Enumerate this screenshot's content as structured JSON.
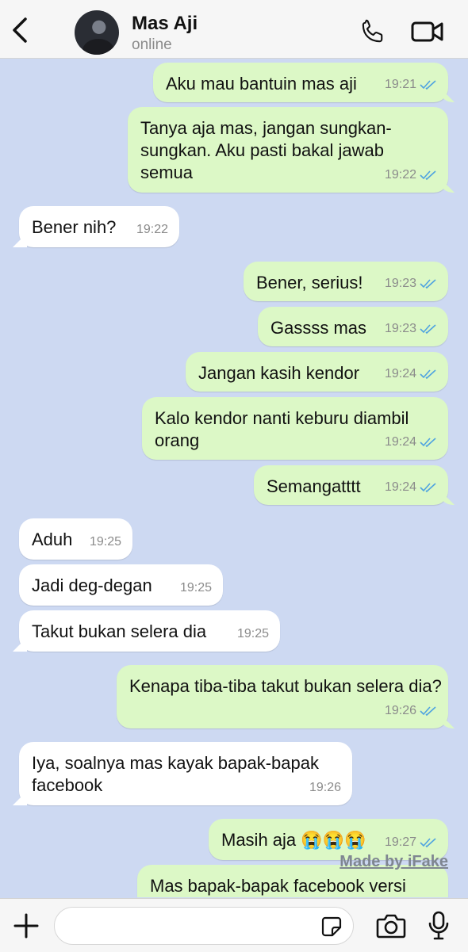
{
  "header": {
    "contact_name": "Mas Aji",
    "status": "online",
    "back_icon": "chevron-left-icon",
    "call_icon": "phone-icon",
    "video_icon": "video-camera-icon"
  },
  "messages": [
    {
      "dir": "out",
      "text": "Aku mau bantuin mas aji",
      "time": "19:21",
      "read": true
    },
    {
      "dir": "out",
      "text": "Tanya aja mas, jangan sungkan-sungkan. Aku pasti bakal jawab semua",
      "time": "19:22",
      "read": true
    },
    {
      "dir": "in",
      "text": "Bener nih?",
      "time": "19:22"
    },
    {
      "dir": "out",
      "text": "Bener, serius!",
      "time": "19:23",
      "read": true
    },
    {
      "dir": "out",
      "text": "Gassss mas",
      "time": "19:23",
      "read": true
    },
    {
      "dir": "out",
      "text": "Jangan kasih kendor",
      "time": "19:24",
      "read": true
    },
    {
      "dir": "out",
      "text": "Kalo kendor nanti keburu diambil orang",
      "time": "19:24",
      "read": true
    },
    {
      "dir": "out",
      "text": "Semangatttt",
      "time": "19:24",
      "read": true
    },
    {
      "dir": "in",
      "text": "Aduh",
      "time": "19:25"
    },
    {
      "dir": "in",
      "text": "Jadi deg-degan",
      "time": "19:25"
    },
    {
      "dir": "in",
      "text": "Takut bukan selera dia",
      "time": "19:25"
    },
    {
      "dir": "out",
      "text": "Kenapa tiba-tiba takut bukan selera dia?",
      "time": "19:26",
      "read": true
    },
    {
      "dir": "in",
      "text": "Iya, soalnya mas kayak bapak-bapak facebook",
      "time": "19:26"
    },
    {
      "dir": "out",
      "text": "Masih aja 😭😭😭",
      "time": "19:27",
      "read": true
    },
    {
      "dir": "out",
      "text": "Mas bapak-bapak facebook versi",
      "time": "",
      "read": false
    }
  ],
  "watermark": "Made by iFake",
  "input": {
    "placeholder": "",
    "value": "",
    "icons": [
      "plus-icon",
      "sticker-icon",
      "camera-icon",
      "microphone-icon"
    ]
  },
  "colors": {
    "background": "#cdd9f2",
    "outgoing": "#dcf8c6",
    "incoming": "#ffffff",
    "read_ticks": "#4fa3e0"
  }
}
